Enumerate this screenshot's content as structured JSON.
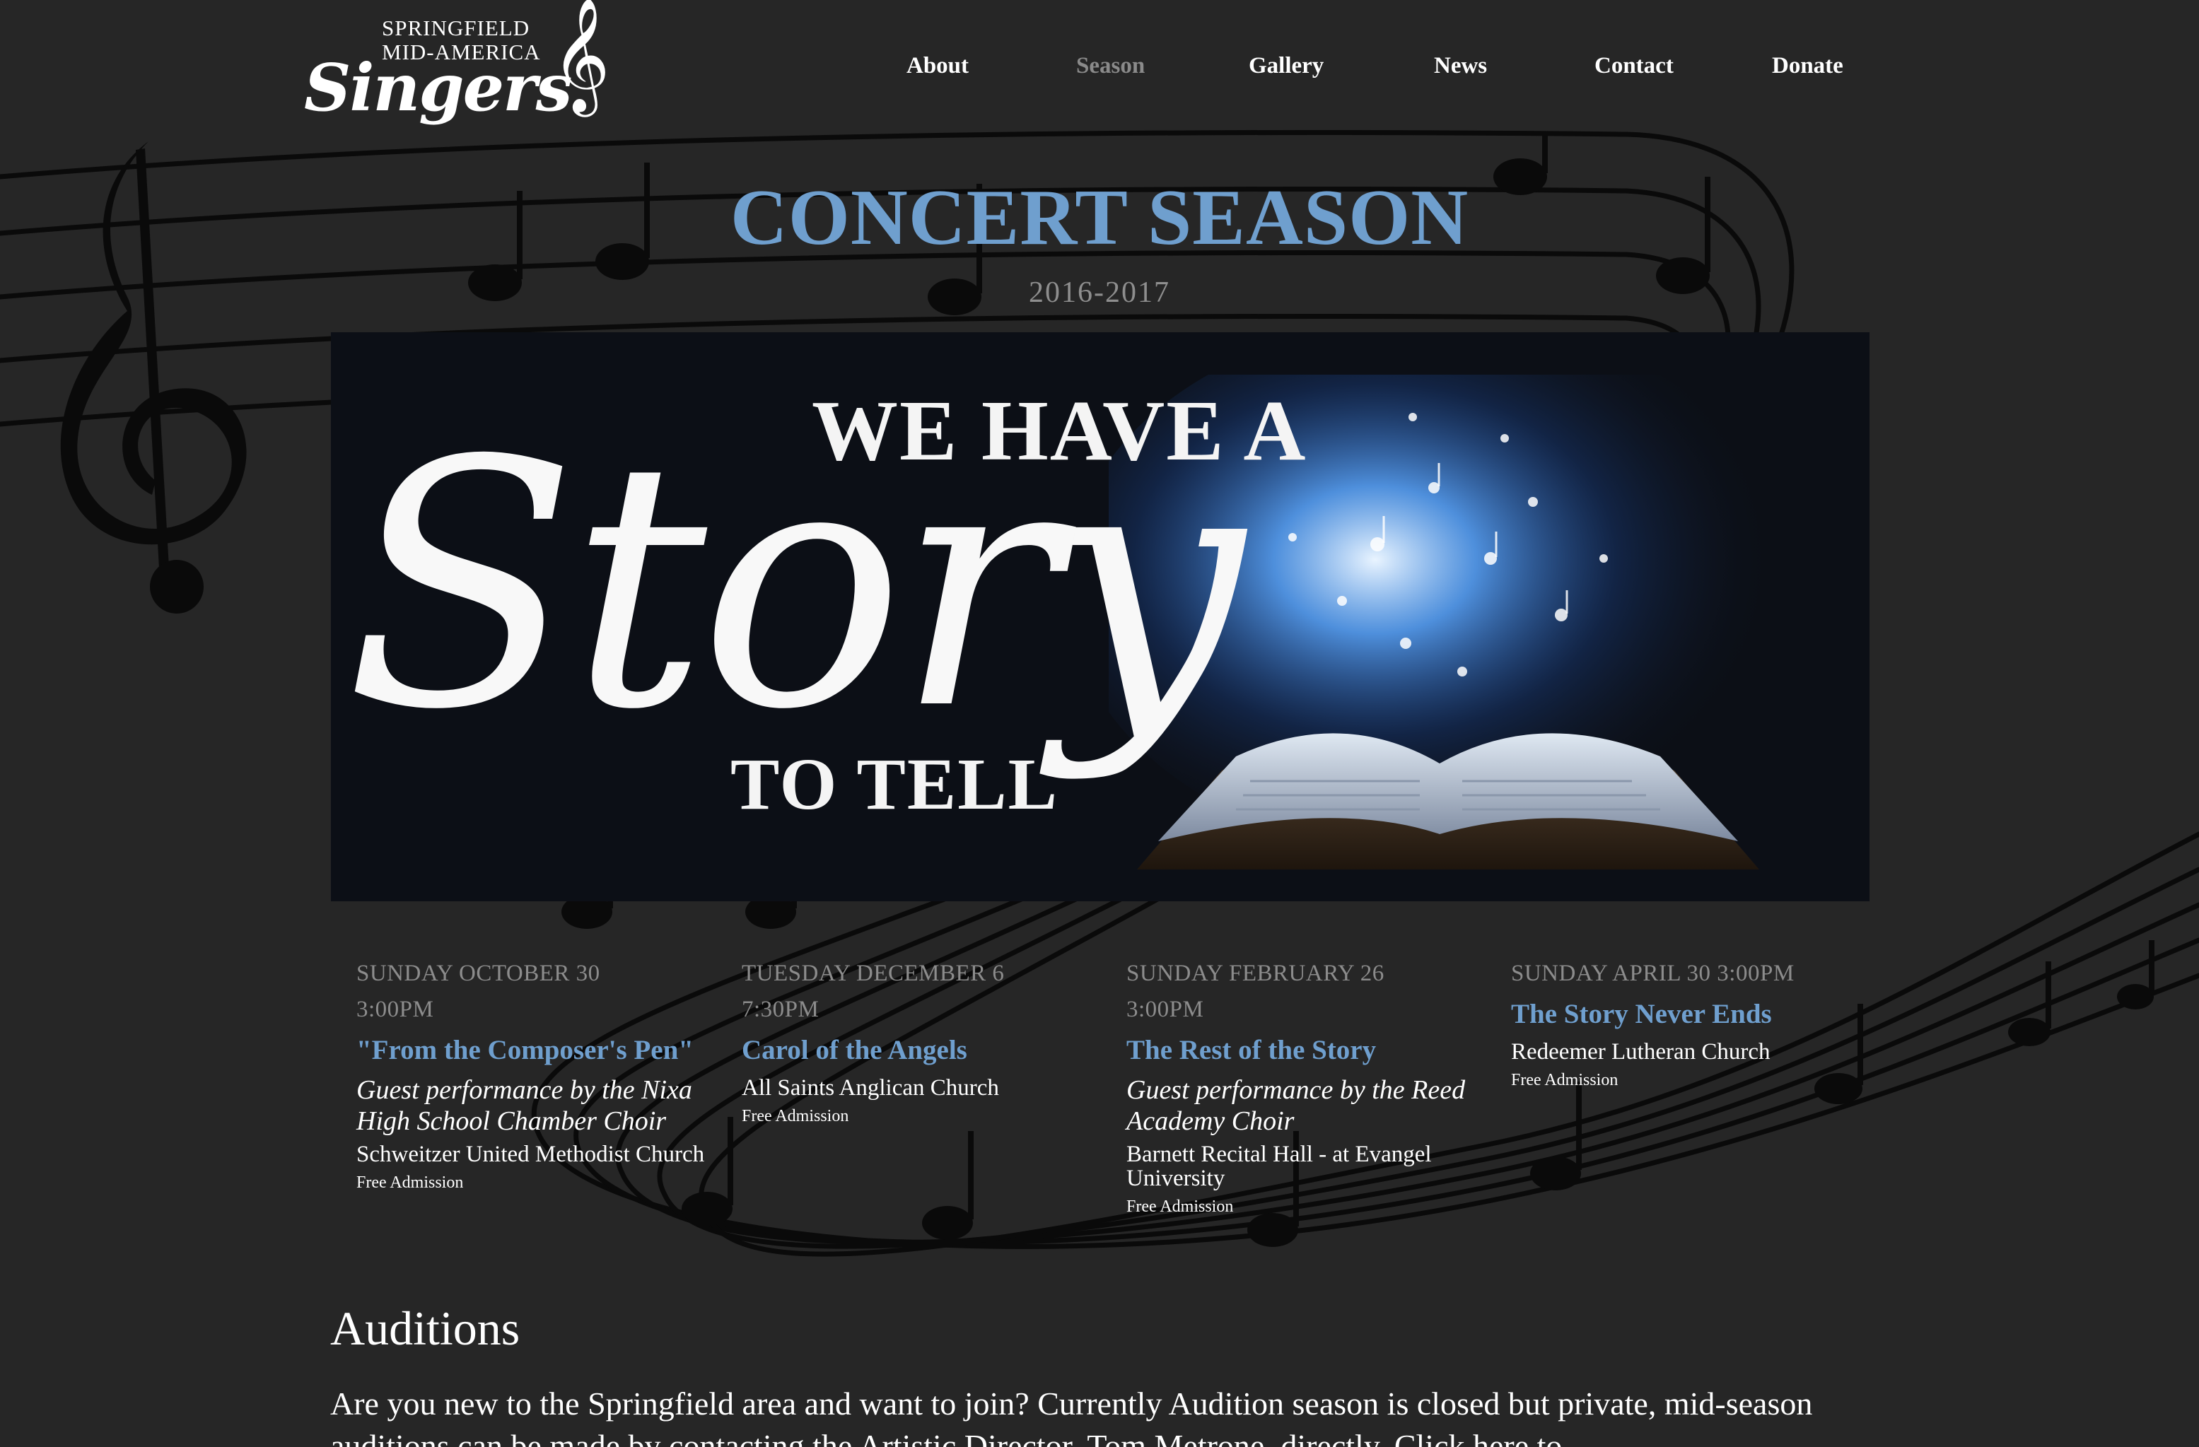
{
  "header": {
    "logo": {
      "line1": "SPRINGFIELD",
      "line2": "MID-AMERICA",
      "script": "Singers"
    },
    "nav": [
      {
        "label": "About",
        "active": false
      },
      {
        "label": "Season",
        "active": true
      },
      {
        "label": "Gallery",
        "active": false
      },
      {
        "label": "News",
        "active": false
      },
      {
        "label": "Contact",
        "active": false
      },
      {
        "label": "Donate",
        "active": false
      }
    ]
  },
  "main": {
    "title": "CONCERT SEASON",
    "season_years": "2016-2017",
    "banner": {
      "top": "WE HAVE A",
      "script": "Story",
      "bottom": "TO TELL"
    },
    "events": [
      {
        "date_line1": "SUNDAY OCTOBER 30",
        "date_line2": "3:00PM",
        "name": "\"From the Composer's Pen\"",
        "guest": "Guest performance by the Nixa High School Chamber Choir",
        "venue": "Schweitzer United Methodist Church",
        "admission": "Free Admission"
      },
      {
        "date_line1": "TUESDAY DECEMBER 6",
        "date_line2": "7:30PM",
        "name": "Carol of the Angels",
        "guest": "",
        "venue": "All Saints Anglican Church",
        "admission": "Free Admission"
      },
      {
        "date_line1": "SUNDAY FEBRUARY 26",
        "date_line2": "3:00PM",
        "name": "The Rest of the Story",
        "guest": "Guest performance by the Reed Academy Choir",
        "venue": "Barnett Recital Hall - at Evangel University",
        "admission": "Free Admission"
      },
      {
        "date_line1": "SUNDAY APRIL 30 3:00PM",
        "date_line2": "",
        "name": "The Story Never Ends",
        "guest": "",
        "venue": "Redeemer Lutheran Church",
        "admission": "Free Admission"
      }
    ],
    "auditions": {
      "heading": "Auditions",
      "text": "Are you new to the Springfield area and want to join? Currently Audition season is closed but private, mid-season auditions can be made by contacting the Artistic Director, Tom Metrone, directly. Click here to"
    }
  },
  "colors": {
    "background": "#262626",
    "accent_blue": "#6f9fce",
    "muted_gray": "#8c8c8c",
    "nav_active": "#8a8a8a",
    "banner_bg": "#0c0f16",
    "staff_lines": "#0a0a0a"
  },
  "icons": {
    "logo_clef": "treble-clef-icon",
    "background_art": "music-staff-decoration"
  }
}
